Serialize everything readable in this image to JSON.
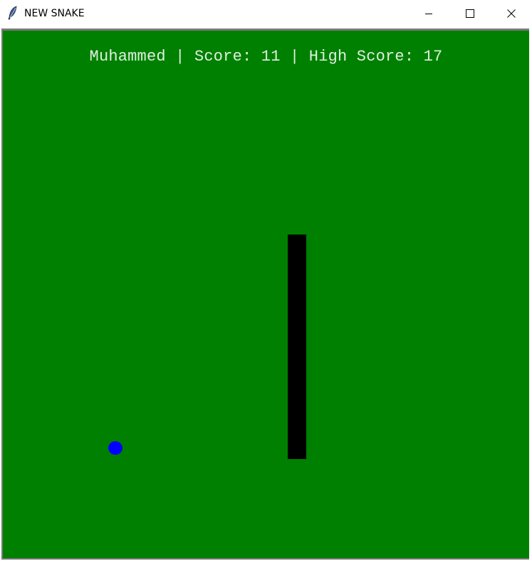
{
  "window": {
    "title": "NEW SNAKE",
    "icon": "feather-icon"
  },
  "controls": {
    "minimize_icon": "minimize-icon",
    "maximize_icon": "maximize-icon",
    "close_icon": "close-icon"
  },
  "game": {
    "score_line": "Muhammed | Score: 11 | High Score: 17",
    "player_name": "Muhammed",
    "score": 11,
    "high_score": 17,
    "colors": {
      "background": "#008000",
      "snake": "#000000",
      "food": "#0000ff",
      "text": "#ffffff"
    }
  }
}
